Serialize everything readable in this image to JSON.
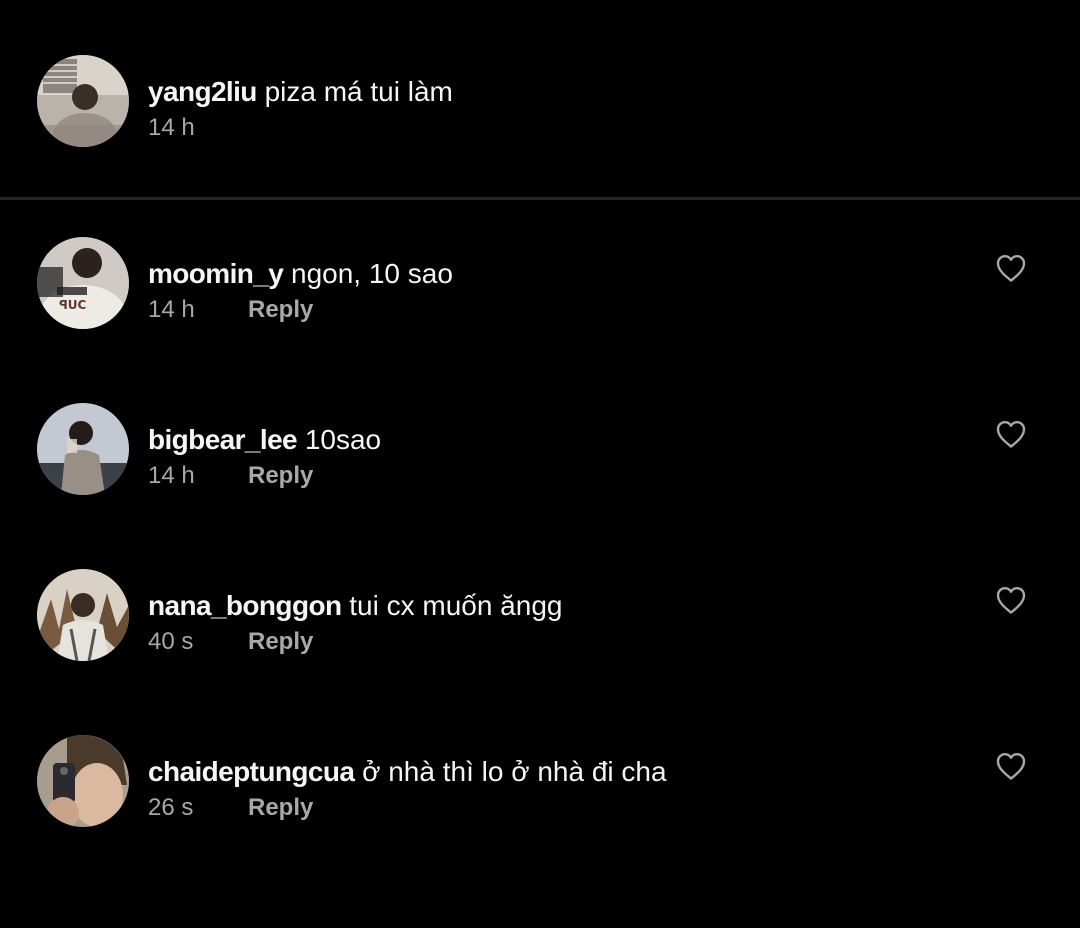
{
  "caption": {
    "username": "yang2liu",
    "text": "piza má tui làm",
    "time": "14 h"
  },
  "reply_label": "Reply",
  "comments": [
    {
      "username": "moomin_y",
      "text": "ngon, 10 sao",
      "time": "14 h"
    },
    {
      "username": "bigbear_lee",
      "text": "10sao",
      "time": "14 h"
    },
    {
      "username": "nana_bonggon",
      "text": "tui cx muốn ăngg",
      "time": "40 s"
    },
    {
      "username": "chaideptungcua",
      "text": "ở nhà thì lo ở nhà đi cha",
      "time": "26 s"
    }
  ],
  "icons": {
    "like": "heart-outline-icon"
  },
  "colors": {
    "background": "#000000",
    "primary_text": "#f5f5f5",
    "secondary_text": "#a8a8a8",
    "divider": "#262626"
  }
}
